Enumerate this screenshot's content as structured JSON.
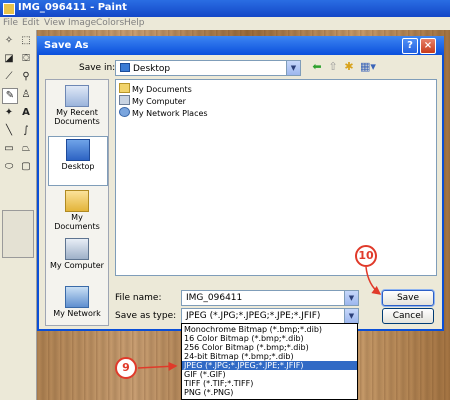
{
  "app": {
    "title": "IMG_096411 - Paint",
    "menu": [
      "File",
      "Edit",
      "View",
      "Image",
      "Colors",
      "Help"
    ]
  },
  "dialog": {
    "title": "Save As",
    "help_button": "?",
    "close_button": "×",
    "save_in_label": "Save in:",
    "save_in_value": "Desktop",
    "places": [
      "My Recent Documents",
      "Desktop",
      "My Documents",
      "My Computer",
      "My Network"
    ],
    "files": [
      "My Documents",
      "My Computer",
      "My Network Places"
    ],
    "file_name_label": "File name:",
    "file_name_value": "IMG_096411",
    "save_type_label": "Save as type:",
    "save_type_value": "JPEG (*.JPG;*.JPEG;*.JPE;*.JFIF)",
    "save_button": "Save",
    "cancel_button": "Cancel",
    "type_options": [
      "Monochrome Bitmap (*.bmp;*.dib)",
      "16 Color Bitmap (*.bmp;*.dib)",
      "256 Color Bitmap (*.bmp;*.dib)",
      "24-bit Bitmap (*.bmp;*.dib)",
      "JPEG (*.JPG;*.JPEG;*.JPE;*.JFIF)",
      "GIF (*.GIF)",
      "TIFF (*.TIF;*.TIFF)",
      "PNG (*.PNG)"
    ],
    "selected_type_index": 4
  },
  "annotations": {
    "step_save": "10",
    "step_type": "9"
  },
  "colors": {
    "accent": "#316ac5",
    "annotation": "#e03a2a",
    "titlebar": "#0a4fdc"
  }
}
